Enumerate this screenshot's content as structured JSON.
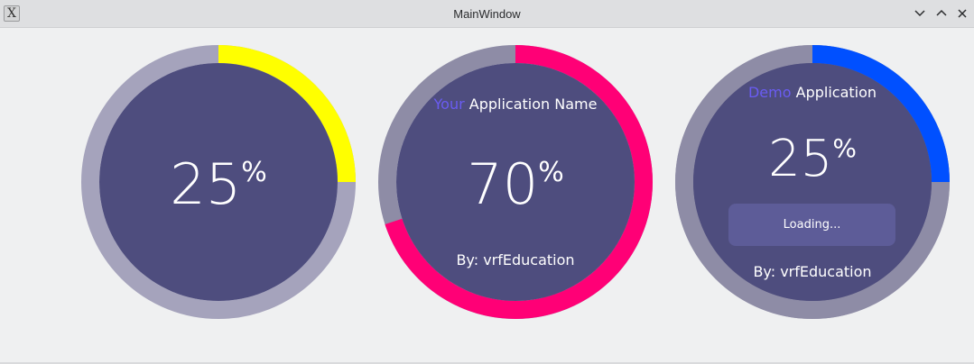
{
  "window": {
    "title": "MainWindow",
    "icon": "x-app-icon",
    "controls": [
      "minimize-icon",
      "maximize-icon",
      "close-icon"
    ]
  },
  "gauges": [
    {
      "value": 25,
      "value_text": "25",
      "unit": "%",
      "progress_fraction": 0.25,
      "progress_color": "#ffff00",
      "track_color": "#a5a3bc",
      "inner_color": "#4e4d7e"
    },
    {
      "title_accent": "Your",
      "title_rest": " Application Name",
      "value": 70,
      "value_text": "70",
      "unit": "%",
      "progress_fraction": 0.7,
      "progress_color": "#ff0076",
      "track_color": "#8e8ca6",
      "inner_color": "#4e4d7e",
      "footer": "By: vrfEducation"
    },
    {
      "title_accent": "Demo",
      "title_rest": " Application",
      "value": 25,
      "value_text": "25",
      "unit": "%",
      "progress_fraction": 0.25,
      "progress_color": "#0050ff",
      "track_color": "#8e8ca6",
      "inner_color": "#4e4d7e",
      "loading_label": "Loading...",
      "loading_color": "#5d5c98",
      "footer": "By: vrfEducation"
    }
  ],
  "colors": {
    "background": "#eff0f1",
    "titlebar": "#dedfe1",
    "accent_text": "#6a5cf2"
  }
}
